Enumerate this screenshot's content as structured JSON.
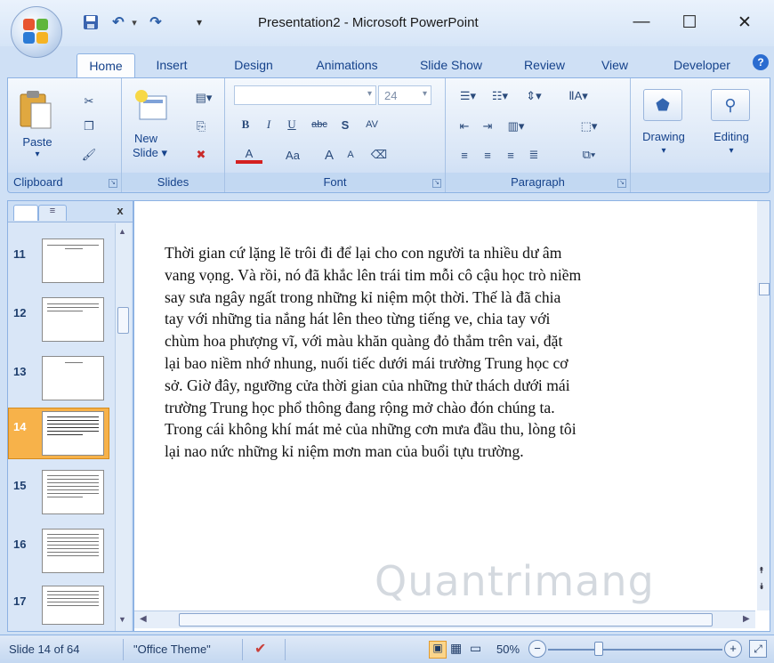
{
  "window": {
    "title": "Presentation2 - Microsoft PowerPoint",
    "minimize_glyph": "—",
    "maximize_glyph": "☐",
    "close_glyph": "✕",
    "help_glyph": "?"
  },
  "quick_access": {
    "save_icon": "save-icon",
    "undo_glyph": "↶",
    "undo_arrow": "▾",
    "redo_glyph": "↷",
    "customize_glyph": "▾"
  },
  "tabs": [
    {
      "label": "Home",
      "active": true
    },
    {
      "label": "Insert"
    },
    {
      "label": "Design"
    },
    {
      "label": "Animations"
    },
    {
      "label": "Slide Show"
    },
    {
      "label": "Review"
    },
    {
      "label": "View"
    },
    {
      "label": "Developer"
    }
  ],
  "ribbon": {
    "clipboard": {
      "label": "Clipboard",
      "paste": "Paste",
      "paste_arrow": "▾"
    },
    "slides": {
      "label": "Slides",
      "new_slide_line1": "New",
      "new_slide_line2": "Slide ▾"
    },
    "font": {
      "label": "Font",
      "font_size": "24",
      "dropdown_arrow": "▾",
      "bold": "B",
      "italic": "I",
      "underline": "U",
      "strike": "abc",
      "shadow": "S",
      "spacing": "AV",
      "color": "A",
      "change_case": "Aa",
      "grow": "A",
      "shrink": "A"
    },
    "paragraph": {
      "label": "Paragraph"
    },
    "drawing": {
      "label": "Drawing",
      "arrow": "▾"
    },
    "editing": {
      "label": "Editing",
      "arrow": "▾"
    }
  },
  "left_pane": {
    "close_glyph": "x",
    "thumbnails": [
      {
        "number": "11"
      },
      {
        "number": "12"
      },
      {
        "number": "13"
      },
      {
        "number": "14",
        "selected": true
      },
      {
        "number": "15"
      },
      {
        "number": "16"
      },
      {
        "number": "17"
      }
    ]
  },
  "slide": {
    "lines": [
      "Thời gian cứ lặng lẽ trôi đi để lại cho con người ta nhiều dư âm",
      "vang vọng. Và rồi, nó đã khắc lên trái tim mỗi cô cậu học trò niềm",
      "say sưa ngây ngất trong những kỉ niệm một thời. Thế là đã chia",
      "tay với những tia nắng hát lên theo từng tiếng ve, chia tay với",
      "chùm hoa phượng vĩ, với màu khăn quàng đỏ thắm trên vai, đặt",
      "lại bao niềm nhớ nhung, nuối tiếc dưới mái trường Trung  học cơ",
      "sở. Giờ đây, ngưỡng cửa thời gian của những thử thách dưới mái",
      "trường Trung học phổ thông đang rộng mở chào đón chúng ta.",
      "Trong cái không khí mát mẻ của những cơn mưa đầu thu, lòng tôi",
      "lại nao nức những kỉ niệm mơn man của buổi tựu trường."
    ],
    "watermark": "Quantrimang"
  },
  "statusbar": {
    "slide_info": "Slide 14 of 64",
    "theme": "\"Office Theme\"",
    "zoom": "50%",
    "zoom_out": "−",
    "zoom_in": "+"
  },
  "colors": {
    "accent": "#15428b",
    "selected_thumb": "#f7b24a"
  }
}
